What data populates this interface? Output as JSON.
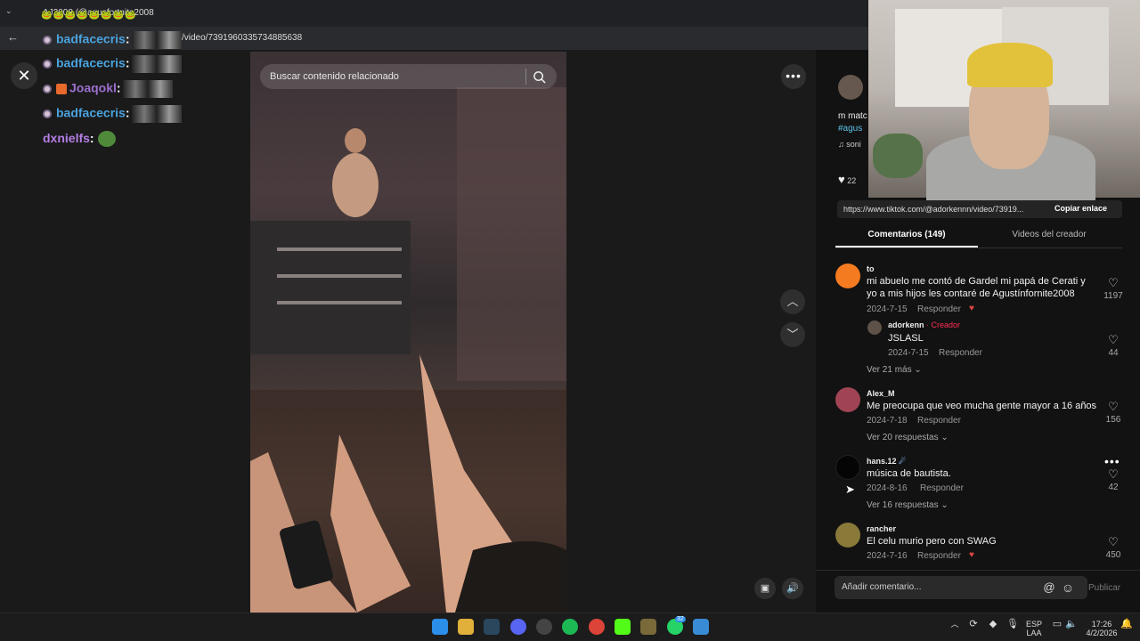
{
  "browser": {
    "tab_title": "AJ2008 (@agusfortnite2008",
    "url": "/video/7391960335734885638"
  },
  "chat": [
    {
      "user": "badfacecris",
      "color": "#4aa3df"
    },
    {
      "user": "badfacecris",
      "color": "#4aa3df"
    },
    {
      "user": "Joaqokl",
      "color": "#9b6fce"
    },
    {
      "user": "badfacecris",
      "color": "#4aa3df"
    },
    {
      "user": "dxnielfs",
      "color": "#b47ee5"
    }
  ],
  "video": {
    "search_placeholder": "Buscar contenido relacionado"
  },
  "sidebar": {
    "desc_line1": "m matc",
    "desc_hashtag": "#agus",
    "sound": "soni",
    "likes": "22",
    "link": "https://www.tiktok.com/@adorkennn/video/73919...",
    "copy_link": "Copiar enlace",
    "tab_comments": "Comentarios (149)",
    "tab_creator": "Videos del creador"
  },
  "comments": [
    {
      "user": "to",
      "text": "mi abuelo me contó de Gardel mi papá de Cerati y yo a mis hijos les contaré de Agustínfornite2008",
      "date": "2024-7-15",
      "reply": "Responder",
      "likes": "1197",
      "avatar_color": "#f47b20"
    },
    {
      "user": "Alex_M",
      "text": "Me preocupa que veo mucha gente mayor a 16 años",
      "date": "2024-7-18",
      "reply": "Responder",
      "likes": "156",
      "more": "Ver 20 respuestas",
      "avatar_color": "#a04455"
    },
    {
      "user": "hans.12",
      "text": "música de bautista.",
      "date": "2024-8-16",
      "reply": "Responder",
      "likes": "42",
      "more": "Ver 16 respuestas",
      "avatar_color": "#050505"
    },
    {
      "user": "rancher",
      "text": "El celu murio pero con SWAG",
      "date": "2024-7-16",
      "reply": "Responder",
      "likes": "450",
      "avatar_color": "#8a7a3a"
    }
  ],
  "creator_reply": {
    "user": "adorkenn",
    "badge": "· Creador",
    "text": "JSLASL",
    "date": "2024-7-15",
    "reply": "Responder",
    "likes": "44",
    "more": "Ver 21 más"
  },
  "comment_box": {
    "placeholder": "Añadir comentario...",
    "publish": "Publicar"
  },
  "taskbar": {
    "lang1": "ESP",
    "lang2": "LAA",
    "time": "17:26",
    "date": "4/2/2026",
    "whatsapp_badge": "32"
  },
  "colors": {
    "accent_red": "#fe2c55",
    "hashtag": "#5ec2e8"
  }
}
